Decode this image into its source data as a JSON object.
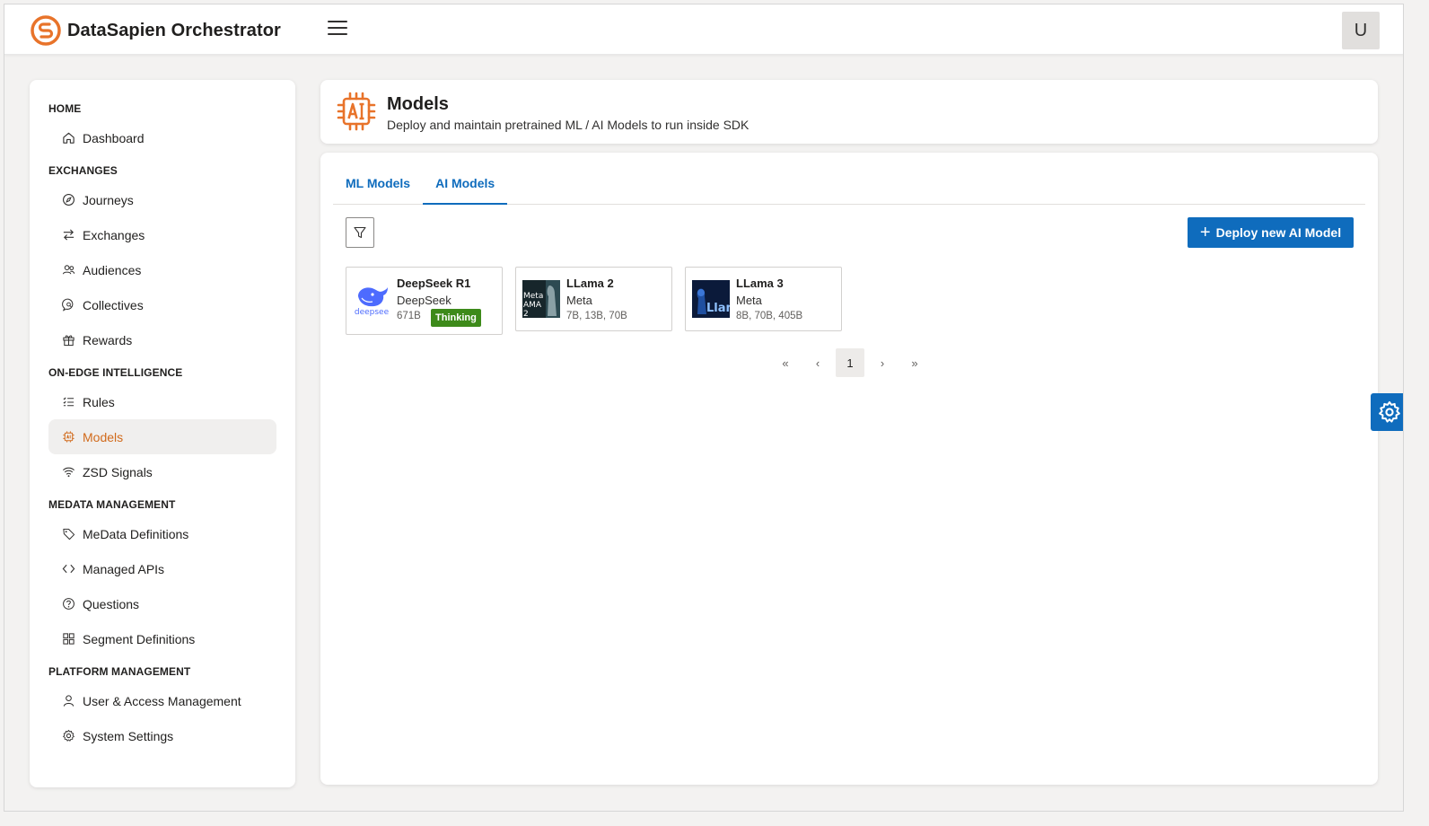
{
  "app": {
    "title": "DataSapien Orchestrator",
    "user_initial": "U"
  },
  "sidebar": {
    "sections": [
      {
        "title": "HOME",
        "items": [
          {
            "label": "Dashboard",
            "icon": "home-icon"
          }
        ]
      },
      {
        "title": "EXCHANGES",
        "items": [
          {
            "label": "Journeys",
            "icon": "compass-icon"
          },
          {
            "label": "Exchanges",
            "icon": "arrows-swap-icon"
          },
          {
            "label": "Audiences",
            "icon": "people-icon"
          },
          {
            "label": "Collectives",
            "icon": "chat-search-icon"
          },
          {
            "label": "Rewards",
            "icon": "gift-icon"
          }
        ]
      },
      {
        "title": "ON-EDGE INTELLIGENCE",
        "items": [
          {
            "label": "Rules",
            "icon": "list-check-icon"
          },
          {
            "label": "Models",
            "icon": "chip-icon",
            "active": true
          },
          {
            "label": "ZSD Signals",
            "icon": "wifi-icon"
          }
        ]
      },
      {
        "title": "MEDATA MANAGEMENT",
        "items": [
          {
            "label": "MeData Definitions",
            "icon": "tag-icon"
          },
          {
            "label": "Managed APIs",
            "icon": "code-icon"
          },
          {
            "label": "Questions",
            "icon": "question-circle-icon"
          },
          {
            "label": "Segment Definitions",
            "icon": "grid-icon"
          }
        ]
      },
      {
        "title": "PLATFORM MANAGEMENT",
        "items": [
          {
            "label": "User & Access Management",
            "icon": "person-icon"
          },
          {
            "label": "System Settings",
            "icon": "gear-icon"
          }
        ]
      }
    ]
  },
  "header": {
    "title": "Models",
    "subtitle": "Deploy and maintain pretrained ML / AI Models to run inside SDK"
  },
  "tabs": [
    {
      "label": "ML Models"
    },
    {
      "label": "AI Models",
      "active": true
    }
  ],
  "toolbar": {
    "deploy_label": "Deploy new AI Model"
  },
  "models": [
    {
      "name": "DeepSeek R1",
      "vendor": "DeepSeek",
      "sizes": "671B",
      "badge": "Thinking",
      "thumb_text": "deepsee"
    },
    {
      "name": "LLama 2",
      "vendor": "Meta",
      "sizes": "7B, 13B, 70B",
      "thumb_text": "Meta AMA 2"
    },
    {
      "name": "LLama 3",
      "vendor": "Meta",
      "sizes": "8B, 70B, 405B",
      "thumb_text": "Llam"
    }
  ],
  "pagination": {
    "first": "«",
    "prev": "‹",
    "current": "1",
    "next": "›",
    "last": "»"
  },
  "colors": {
    "accent": "#0f6cbd",
    "brand": "#e8732a",
    "badge": "#3d8a1a",
    "active_nav": "#d16a1b"
  }
}
